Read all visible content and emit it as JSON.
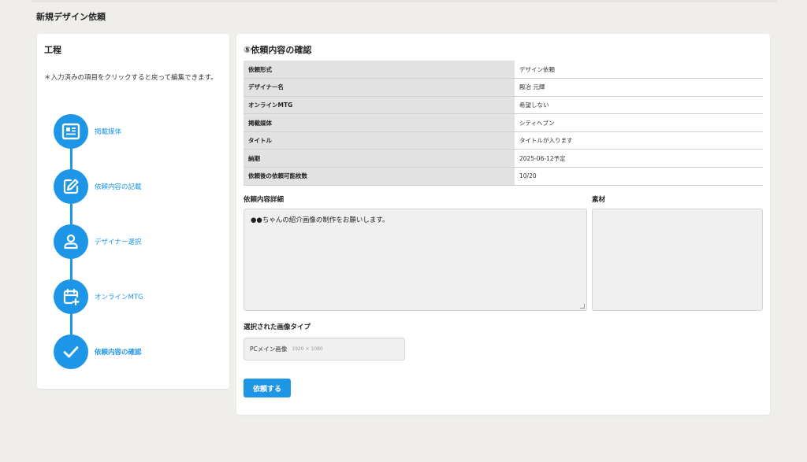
{
  "page": {
    "title": "新規デザイン依頼"
  },
  "process": {
    "heading": "工程",
    "note": "＊入力済みの項目をクリックすると戻って編集できます。",
    "steps": [
      {
        "label": "掲載媒体",
        "icon": "newspaper-icon"
      },
      {
        "label": "依頼内容の記載",
        "icon": "edit-icon"
      },
      {
        "label": "デザイナー選択",
        "icon": "person-icon"
      },
      {
        "label": "オンラインMTG",
        "icon": "calendar-plus-icon"
      },
      {
        "label": "依頼内容の確認",
        "icon": "check-icon"
      }
    ]
  },
  "confirm": {
    "heading": "⑤依頼内容の確認",
    "rows": [
      {
        "key": "依頼形式",
        "value": "デザイン依頼"
      },
      {
        "key": "デザイナー名",
        "value": "殿冶 元輝"
      },
      {
        "key": "オンラインMTG",
        "value": "希望しない"
      },
      {
        "key": "掲載媒体",
        "value": "シティヘブン"
      },
      {
        "key": "タイトル",
        "value": "タイトルが入ります"
      },
      {
        "key": "納期",
        "value": "2025-06-12予定"
      },
      {
        "key": "依頼後の依頼可能枚数",
        "value": "10/20"
      }
    ],
    "detail_label": "依頼内容詳細",
    "detail_text": "●●ちゃんの紹介画像の制作をお願いします。",
    "material_label": "素材",
    "image_type_label": "選択された画像タイプ",
    "image_type": "PCメイン画像",
    "image_size": "1920 × 1080",
    "submit_label": "依頼する"
  },
  "colors": {
    "accent": "#1e96e8",
    "background": "#efeeeb"
  }
}
